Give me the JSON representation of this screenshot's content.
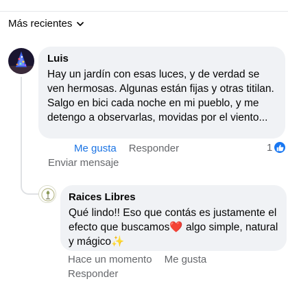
{
  "sort": {
    "label": "Más recientes",
    "icon": "chevron-down-icon"
  },
  "comments": [
    {
      "author": "Luis",
      "text": "Hay un jardín con esas luces, y de verdad se ven hermosas. Algunas están fijas y otras titilan. Salgo en bici cada noche en mi pueblo, y me detengo a observarlas, movidas por el viento...",
      "actions": {
        "like": "Me gusta",
        "reply": "Responder",
        "message": "Enviar mensaje"
      },
      "reaction": {
        "count": "1",
        "icon": "thumbs-up-icon",
        "color": "#1877f2"
      },
      "liked": true
    },
    {
      "author": "Raices Libres",
      "text": "Qué lindo!! Eso que contás es justamente el efecto que buscamos❤️ algo simple, natural y mágico✨",
      "actions": {
        "time": "Hace un momento",
        "like": "Me gusta",
        "reply": "Responder"
      },
      "is_reply": true
    }
  ],
  "colors": {
    "bubble": "#f0f2f5",
    "meta": "#65676b",
    "accent": "#1b74e4"
  }
}
